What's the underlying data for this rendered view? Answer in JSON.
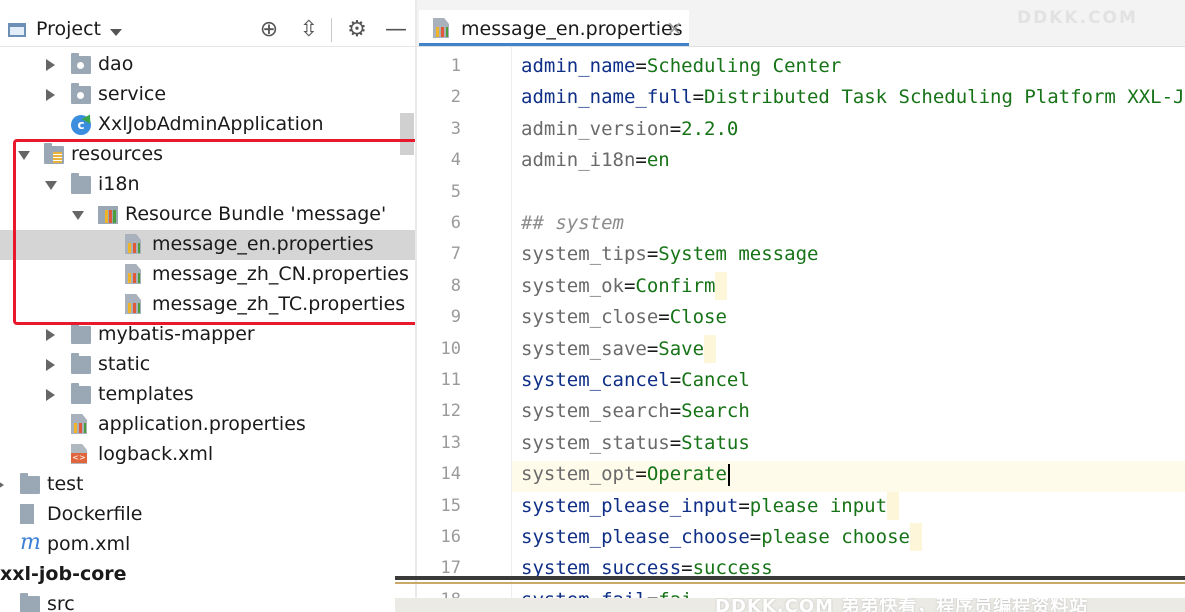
{
  "project_panel": {
    "title": "Project",
    "icons": [
      "crosshair-icon",
      "collapse-icon",
      "gear-icon",
      "minimize-icon"
    ]
  },
  "tree": [
    {
      "label": "dao",
      "icon": "package-folder-icon",
      "arrow": "right",
      "indent": 1
    },
    {
      "label": "service",
      "icon": "package-folder-icon",
      "arrow": "right",
      "indent": 1
    },
    {
      "label": "XxlJobAdminApplication",
      "icon": "java-class-icon",
      "arrow": "none",
      "indent": 1
    },
    {
      "label": "resources",
      "icon": "resources-folder-icon",
      "arrow": "down",
      "indent": 0
    },
    {
      "label": "i18n",
      "icon": "folder-icon",
      "arrow": "down",
      "indent": 1
    },
    {
      "label": "Resource Bundle 'message'",
      "icon": "resource-bundle-icon",
      "arrow": "down",
      "indent": 2
    },
    {
      "label": "message_en.properties",
      "icon": "properties-file-icon",
      "arrow": "none",
      "indent": 3,
      "selected": true
    },
    {
      "label": "message_zh_CN.properties",
      "icon": "properties-file-icon",
      "arrow": "none",
      "indent": 3
    },
    {
      "label": "message_zh_TC.properties",
      "icon": "properties-file-icon",
      "arrow": "none",
      "indent": 3
    },
    {
      "label": "mybatis-mapper",
      "icon": "folder-icon",
      "arrow": "right",
      "indent": 1
    },
    {
      "label": "static",
      "icon": "folder-icon",
      "arrow": "right",
      "indent": 1
    },
    {
      "label": "templates",
      "icon": "folder-icon",
      "arrow": "right",
      "indent": 1
    },
    {
      "label": "application.properties",
      "icon": "properties-file-icon",
      "arrow": "none",
      "indent": 1
    },
    {
      "label": "logback.xml",
      "icon": "xml-file-icon",
      "arrow": "none",
      "indent": 1
    },
    {
      "label": "test",
      "icon": "folder-icon",
      "arrow": "right",
      "indent": -1
    },
    {
      "label": "Dockerfile",
      "icon": "docker-file-icon",
      "arrow": "none",
      "indent": -1
    },
    {
      "label": "pom.xml",
      "icon": "maven-icon",
      "arrow": "none",
      "indent": -1
    },
    {
      "label": "xxl-job-core",
      "icon": "none",
      "arrow": "none",
      "indent": -2,
      "bold": true
    },
    {
      "label": "src",
      "icon": "folder-icon",
      "arrow": "none",
      "indent": -1
    }
  ],
  "editor": {
    "tab_label": "message_en.properties",
    "tab_close": "×",
    "watermark": "DDKK.COM",
    "current_line": 14,
    "lines": [
      {
        "n": "1",
        "key": "admin_name",
        "val": "Scheduling Center",
        "style": "dark"
      },
      {
        "n": "2",
        "key": "admin_name_full",
        "val": "Distributed Task Scheduling Platform XXL-JOB",
        "style": "dark"
      },
      {
        "n": "3",
        "key": "admin_version",
        "val": "2.2.0",
        "style": "gray"
      },
      {
        "n": "4",
        "key": "admin_i18n",
        "val": "en",
        "style": "gray"
      },
      {
        "n": "5",
        "key": "",
        "val": "",
        "style": "blank"
      },
      {
        "n": "6",
        "key": "## system",
        "val": "",
        "style": "comment"
      },
      {
        "n": "7",
        "key": "system_tips",
        "val": "System message",
        "style": "gray"
      },
      {
        "n": "8",
        "key": "system_ok",
        "val": "Confirm",
        "style": "gray",
        "trail": true
      },
      {
        "n": "9",
        "key": "system_close",
        "val": "Close",
        "style": "gray"
      },
      {
        "n": "10",
        "key": "system_save",
        "val": "Save",
        "style": "gray",
        "trail": true
      },
      {
        "n": "11",
        "key": "system_cancel",
        "val": "Cancel",
        "style": "dark"
      },
      {
        "n": "12",
        "key": "system_search",
        "val": "Search",
        "style": "gray"
      },
      {
        "n": "13",
        "key": "system_status",
        "val": "Status",
        "style": "gray"
      },
      {
        "n": "14",
        "key": "system_opt",
        "val": "Operate",
        "style": "gray",
        "caret": true
      },
      {
        "n": "15",
        "key": "system_please_input",
        "val": "please input",
        "style": "dark",
        "trail": true
      },
      {
        "n": "16",
        "key": "system_please_choose",
        "val": "please choose",
        "style": "dark",
        "trail": true
      },
      {
        "n": "17",
        "key": "system_success",
        "val": "success",
        "style": "dark"
      },
      {
        "n": "18",
        "key": "system_fail",
        "val": "fai",
        "style": "dark"
      }
    ]
  },
  "banner_text": "DDKK.COM 弟弟快看，程序员编程资料站",
  "colors": {
    "highlight": "#e8192c",
    "key_dark": "#0f2f87",
    "key_gray": "#6a6a6a",
    "value": "#177317",
    "selection": "#d5d5d5",
    "tab_underline": "#4083c9"
  }
}
